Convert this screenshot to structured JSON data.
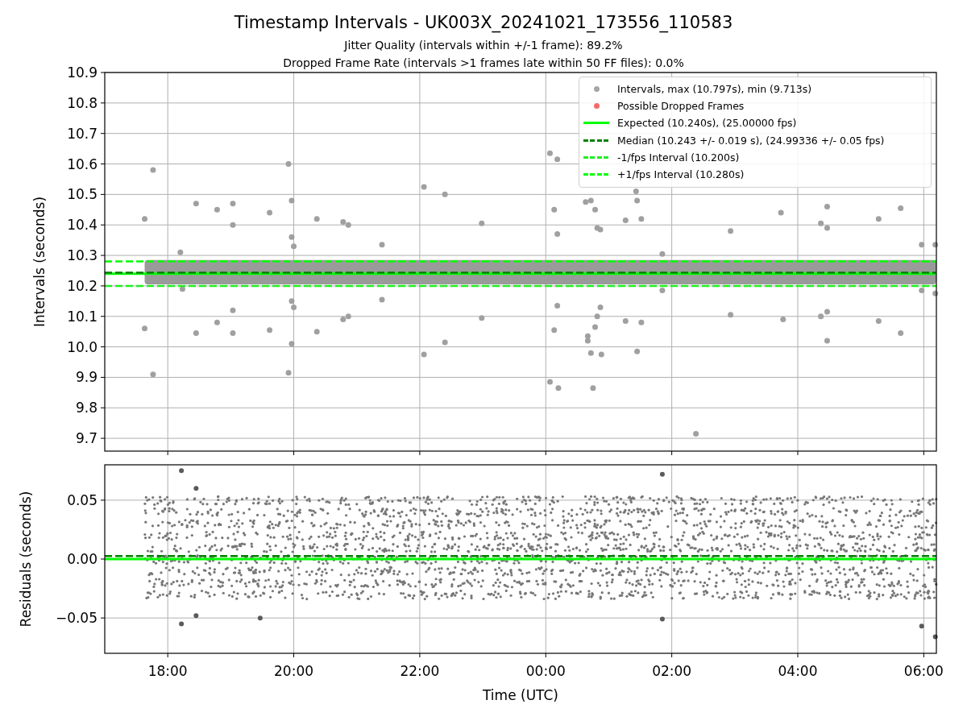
{
  "title": "Timestamp Intervals - UK003X_20241021_173556_110583",
  "subtitles": [
    "Jitter Quality (intervals within +/-1 frame): 89.2%",
    "Dropped Frame Rate (intervals >1 frames late within 50 FF files): 0.0%"
  ],
  "top_plot": {
    "chart_data": {
      "type": "scatter",
      "ylabel": "Intervals (seconds)",
      "xlim": [
        "2024-10-21T17:00",
        "2024-10-22T06:12"
      ],
      "ylim": [
        9.658,
        10.9
      ],
      "yticks": [
        {
          "value": 9.7,
          "label": "9.7"
        },
        {
          "value": 9.8,
          "label": "9.8"
        },
        {
          "value": 9.9,
          "label": "9.9"
        },
        {
          "value": 10.0,
          "label": "10.0"
        },
        {
          "value": 10.1,
          "label": "10.1"
        },
        {
          "value": 10.2,
          "label": "10.2"
        },
        {
          "value": 10.3,
          "label": "10.3"
        },
        {
          "value": 10.4,
          "label": "10.4"
        },
        {
          "value": 10.5,
          "label": "10.5"
        },
        {
          "value": 10.6,
          "label": "10.6"
        },
        {
          "value": 10.7,
          "label": "10.7"
        },
        {
          "value": 10.8,
          "label": "10.8"
        },
        {
          "value": 10.9,
          "label": "10.9"
        }
      ],
      "x": [
        "2024-10-21T17:38",
        "2024-10-21T17:38",
        "2024-10-21T17:46",
        "2024-10-21T17:46",
        "2024-10-21T18:12",
        "2024-10-21T18:14",
        "2024-10-21T18:27",
        "2024-10-21T18:27",
        "2024-10-21T18:47",
        "2024-10-21T18:47",
        "2024-10-21T19:02",
        "2024-10-21T19:02",
        "2024-10-21T19:02",
        "2024-10-21T19:02",
        "2024-10-21T19:37",
        "2024-10-21T19:37",
        "2024-10-21T19:55",
        "2024-10-21T19:55",
        "2024-10-21T19:58",
        "2024-10-21T19:58",
        "2024-10-21T20:00",
        "2024-10-21T19:58",
        "2024-10-21T20:00",
        "2024-10-21T19:58",
        "2024-10-21T20:22",
        "2024-10-21T20:22",
        "2024-10-21T20:47",
        "2024-10-21T20:52",
        "2024-10-21T20:47",
        "2024-10-21T20:52",
        "2024-10-21T21:24",
        "2024-10-21T21:24",
        "2024-10-21T22:04",
        "2024-10-21T22:04",
        "2024-10-21T22:24",
        "2024-10-21T22:24",
        "2024-10-21T22:59",
        "2024-10-21T22:59",
        "2024-10-22T00:04",
        "2024-10-22T00:11",
        "2024-10-22T00:08",
        "2024-10-22T00:11",
        "2024-10-22T00:08",
        "2024-10-22T00:11",
        "2024-10-22T00:04",
        "2024-10-22T00:12",
        "2024-10-22T00:38",
        "2024-10-22T00:43",
        "2024-10-22T00:47",
        "2024-10-22T00:49",
        "2024-10-22T00:52",
        "2024-10-22T00:40",
        "2024-10-22T00:40",
        "2024-10-22T00:43",
        "2024-10-22T00:47",
        "2024-10-22T00:49",
        "2024-10-22T00:52",
        "2024-10-22T00:53",
        "2024-10-22T00:45",
        "2024-10-22T01:16",
        "2024-10-22T01:16",
        "2024-10-22T01:26",
        "2024-10-22T01:27",
        "2024-10-22T01:31",
        "2024-10-22T01:27",
        "2024-10-22T01:31",
        "2024-10-22T01:51",
        "2024-10-22T01:51",
        "2024-10-22T02:23",
        "2024-10-22T02:56",
        "2024-10-22T02:56",
        "2024-10-22T03:44",
        "2024-10-22T03:46",
        "2024-10-22T04:22",
        "2024-10-22T04:28",
        "2024-10-22T04:28",
        "2024-10-22T04:22",
        "2024-10-22T04:28",
        "2024-10-22T04:28",
        "2024-10-22T05:17",
        "2024-10-22T05:17",
        "2024-10-22T05:38",
        "2024-10-22T05:38",
        "2024-10-22T05:58",
        "2024-10-22T06:11",
        "2024-10-22T05:58",
        "2024-10-22T06:11"
      ],
      "series": [
        {
          "color": "#a0a0a0",
          "values": [
            10.42,
            10.06,
            10.58,
            9.91,
            10.31,
            10.19,
            10.47,
            10.045,
            10.45,
            10.08,
            10.47,
            10.4,
            10.12,
            10.045,
            10.44,
            10.055,
            10.6,
            9.915,
            10.48,
            10.36,
            10.33,
            10.15,
            10.13,
            10.01,
            10.42,
            10.05,
            10.41,
            10.4,
            10.09,
            10.1,
            10.155,
            10.335,
            10.525,
            9.975,
            10.5,
            10.015,
            10.405,
            10.095,
            10.635,
            10.615,
            10.45,
            10.37,
            10.055,
            10.135,
            9.885,
            9.865,
            10.475,
            10.48,
            10.45,
            10.39,
            10.385,
            10.035,
            10.02,
            9.98,
            10.065,
            10.1,
            10.13,
            9.975,
            9.865,
            10.415,
            10.085,
            10.51,
            10.48,
            10.42,
            9.985,
            10.08,
            10.305,
            10.185,
            9.715,
            10.38,
            10.105,
            10.44,
            10.09,
            10.405,
            10.39,
            10.46,
            10.1,
            10.115,
            10.02,
            10.42,
            10.085,
            10.455,
            10.045,
            10.335,
            10.335,
            10.185,
            10.175
          ]
        }
      ],
      "grid": true,
      "bands": [
        {
          "axis": "y",
          "from": 10.205,
          "to": 10.285,
          "color": "#9a9a9a"
        }
      ],
      "ref_lines": [
        {
          "axis": "y",
          "value": 10.28,
          "color": "#00ff00"
        },
        {
          "axis": "y",
          "value": 10.2,
          "color": "#22ee22"
        },
        {
          "axis": "y",
          "value": 10.24,
          "color": "#00ff00"
        },
        {
          "axis": "y",
          "value": 10.243,
          "color": "#008000"
        }
      ]
    },
    "legend": [
      {
        "kind": "dot",
        "label": "Intervals, max (10.797s), min (9.713s)",
        "color": "#a6a6a6"
      },
      {
        "kind": "dot",
        "label": "Possible Dropped Frames",
        "color": "#f26b6b"
      },
      {
        "kind": "solid",
        "label": "Expected (10.240s), (25.00000 fps)",
        "color": "#00ff00"
      },
      {
        "kind": "dashed",
        "label": "Median (10.243 +/- 0.019 s), (24.99336 +/- 0.05 fps)",
        "color": "#008000"
      },
      {
        "kind": "dashed",
        "label": "-1/fps Interval (10.200s)",
        "color": "#22ee22"
      },
      {
        "kind": "dashed",
        "label": "+1/fps Interval (10.280s)",
        "color": "#00ff00"
      }
    ]
  },
  "residuals_plot": {
    "chart_data": {
      "type": "scatter",
      "xlabel": "Time (UTC)",
      "ylabel": "Residuals (seconds)",
      "xlim": [
        "2024-10-21T17:00",
        "2024-10-22T06:12"
      ],
      "ylim": [
        -0.08,
        0.08
      ],
      "xticks": [
        {
          "value": "2024-10-21T18:00",
          "label": "18:00"
        },
        {
          "value": "2024-10-21T20:00",
          "label": "20:00"
        },
        {
          "value": "2024-10-21T22:00",
          "label": "22:00"
        },
        {
          "value": "2024-10-22T00:00",
          "label": "00:00"
        },
        {
          "value": "2024-10-22T02:00",
          "label": "02:00"
        },
        {
          "value": "2024-10-22T04:00",
          "label": "04:00"
        },
        {
          "value": "2024-10-22T06:00",
          "label": "06:00"
        }
      ],
      "yticks": [
        {
          "value": -0.05,
          "label": "−0.05"
        },
        {
          "value": 0,
          "label": "0.00"
        },
        {
          "value": 0.05,
          "label": "0.05"
        }
      ],
      "x": [
        "2024-10-21T18:13",
        "2024-10-21T18:13",
        "2024-10-21T18:27",
        "2024-10-21T18:27",
        "2024-10-21T19:28",
        "2024-10-22T01:51",
        "2024-10-22T01:51",
        "2024-10-22T05:58",
        "2024-10-22T06:11"
      ],
      "series": [
        {
          "color": "#5a5a5a",
          "values": [
            0.075,
            -0.055,
            0.06,
            -0.048,
            -0.05,
            0.072,
            -0.051,
            -0.057,
            -0.066
          ]
        }
      ],
      "grid": true,
      "ref_lines": [
        {
          "axis": "y",
          "value": 0,
          "color": "#00ff00"
        },
        {
          "axis": "y",
          "value": 0.0025,
          "color": "#008000"
        }
      ]
    }
  }
}
